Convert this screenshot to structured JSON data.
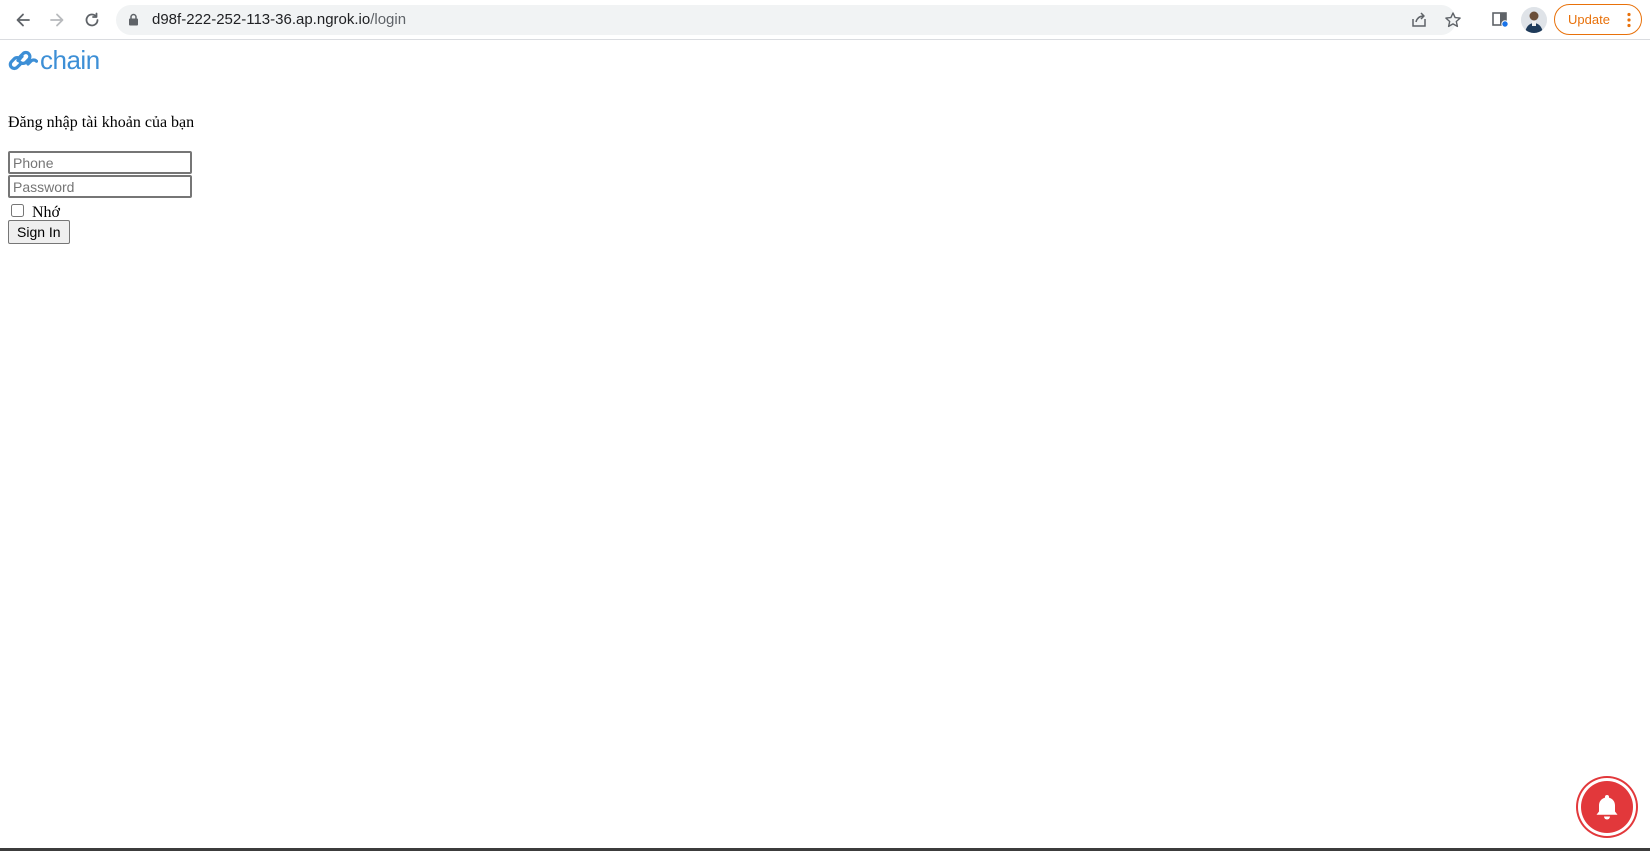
{
  "browser": {
    "url_host": "d98f-222-252-113-36.ap.ngrok.io",
    "url_path": "/login",
    "update_label": "Update",
    "icons": {
      "back": "back-arrow-icon",
      "forward": "forward-arrow-icon",
      "reload": "reload-icon",
      "lock": "lock-icon",
      "share": "share-icon",
      "bookmark": "star-icon",
      "side_panel": "side-panel-icon",
      "menu": "kebab-menu-icon"
    }
  },
  "page": {
    "logo_text": "chain",
    "heading": "Đăng nhập tài khoản của bạn",
    "phone_placeholder": "Phone",
    "password_placeholder": "Password",
    "remember_label": "Nhớ",
    "signin_label": "Sign In"
  },
  "colors": {
    "brand_blue": "#3d8fd6",
    "update_orange": "#e8710a",
    "bell_red": "#e2383b"
  }
}
